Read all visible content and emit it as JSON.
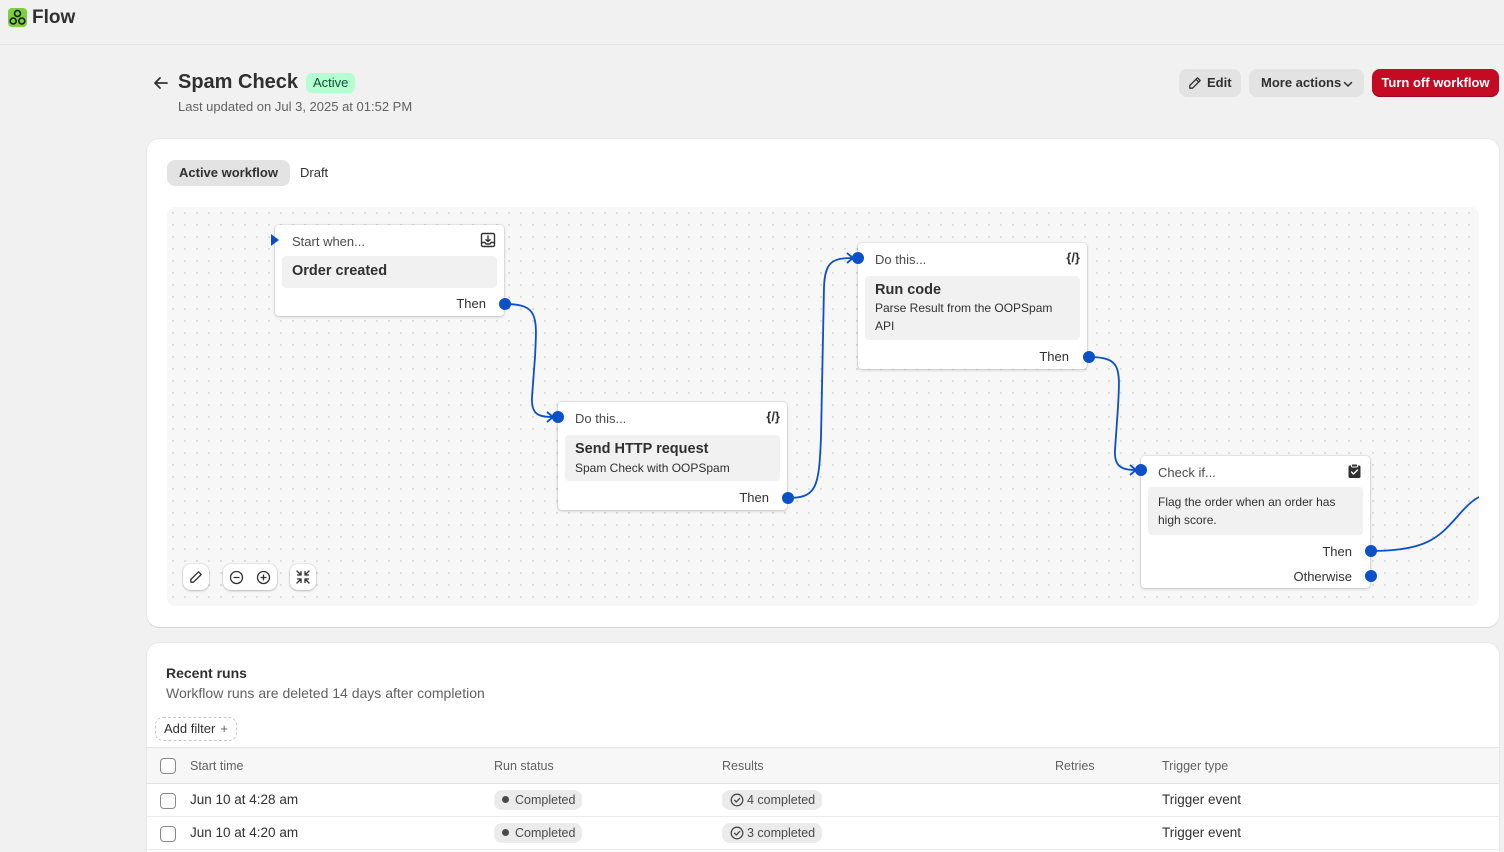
{
  "app": {
    "name": "Flow"
  },
  "header": {
    "title": "Spam Check",
    "status": "Active",
    "last_updated": "Last updated on Jul 3, 2025 at 01:52 PM",
    "edit_label": "Edit",
    "more_actions_label": "More actions",
    "turn_off_label": "Turn off workflow"
  },
  "tabs": [
    "Active workflow",
    "Draft"
  ],
  "workflow": {
    "trigger": {
      "head": "Start when...",
      "title": "Order created",
      "then": "Then",
      "icon": "inbox-download-icon"
    },
    "action_http": {
      "head": "Do this...",
      "icon_text": "{/}",
      "title": "Send HTTP request",
      "sub": "Spam Check with OOPSpam",
      "then": "Then"
    },
    "action_code": {
      "head": "Do this...",
      "icon_text": "{/}",
      "title": "Run code",
      "sub": "Parse Result from the OOPSpam API",
      "then": "Then"
    },
    "condition": {
      "head": "Check if...",
      "icon": "clipboard-check-icon",
      "sub": "Flag the order when an order has high score.",
      "then": "Then",
      "otherwise": "Otherwise"
    }
  },
  "runs": {
    "title": "Recent runs",
    "subtitle": "Workflow runs are deleted 14 days after completion",
    "add_filter": "Add filter",
    "columns": [
      "Start time",
      "Run status",
      "Results",
      "Retries",
      "Trigger type"
    ],
    "rows": [
      {
        "start": "Jun 10 at 4:28 am",
        "status": "Completed",
        "results": "4 completed",
        "retries": "",
        "trigger": "Trigger event"
      },
      {
        "start": "Jun 10 at 4:20 am",
        "status": "Completed",
        "results": "3 completed",
        "retries": "",
        "trigger": "Trigger event"
      }
    ]
  },
  "colors": {
    "accent": "#0b50c9",
    "danger": "#c70a24",
    "badge_bg": "#b4fed2"
  }
}
